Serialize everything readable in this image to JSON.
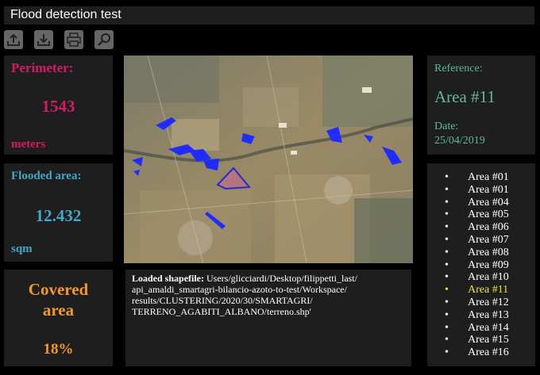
{
  "app": {
    "title": "Flood detection test"
  },
  "toolbar": {
    "buttons": [
      {
        "icon": "upload-icon"
      },
      {
        "icon": "download-icon"
      },
      {
        "icon": "print-icon"
      },
      {
        "icon": "search-icon"
      }
    ]
  },
  "perimeter": {
    "label": "Perimeter:",
    "value": "1543",
    "unit": "meters"
  },
  "flooded": {
    "label": "Flooded area:",
    "value": "12.432",
    "unit": "sqm"
  },
  "covered": {
    "label": "Covered area",
    "value": "18%"
  },
  "reference": {
    "label": "Reference:",
    "value": "Area #11",
    "date_label": "Date:",
    "date": "25/04/2019"
  },
  "log": {
    "label": "Loaded shapefile:",
    "path": " Users/glicciardi/Desktop/filippetti_last/ api_amaldi_smartagri-bilancio-azoto-to-test/Workspace/ results/CLUSTERING/2020/30/SMARTAGRI/ TERRENO_AGABITI_ALBANO/terreno.shp'"
  },
  "areas": {
    "selected_index": 9,
    "items": [
      "Area #01",
      "Area #01",
      "Area #04",
      "Area #05",
      "Area #06",
      "Area #07",
      "Area #08",
      "Area #09",
      "Area #10",
      "Area #11",
      "Area #12",
      "Area #13",
      "Area #14",
      "Area #15",
      "Area #16"
    ]
  },
  "colors": {
    "perimeter": "#d8196a",
    "flooded": "#3fa9c8",
    "covered": "#f39a1e",
    "reference": "#5fb89c",
    "selected_area": "#f0e23a",
    "flood_overlay": "#1f2cff"
  }
}
